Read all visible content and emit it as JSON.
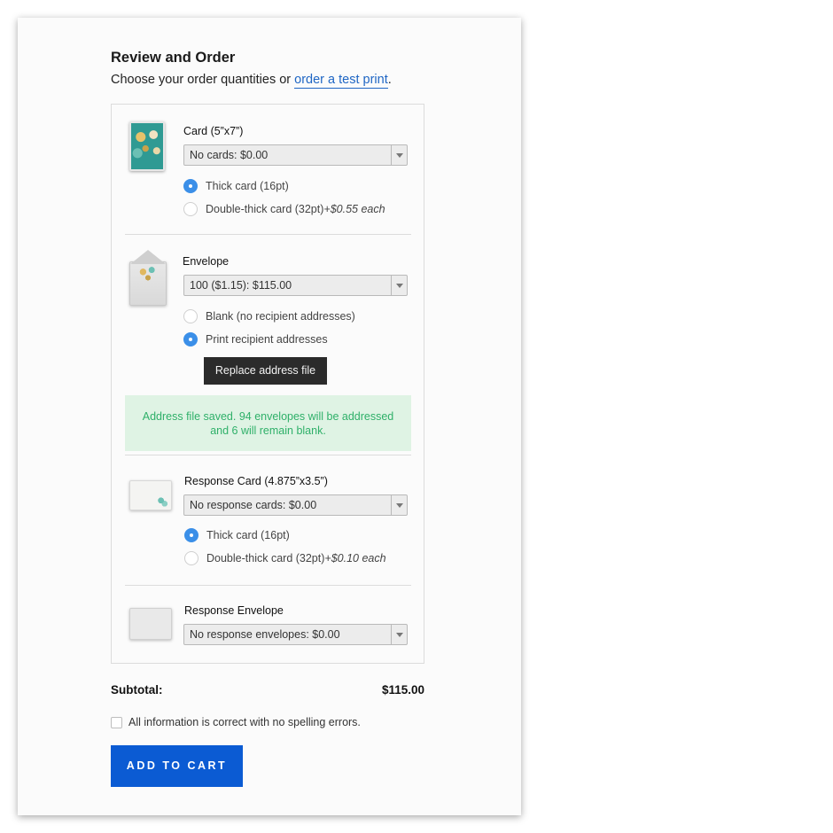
{
  "header": {
    "title": "Review and Order",
    "subtitle_text": "Choose your order quantities or ",
    "subtitle_link": "order a test print",
    "subtitle_end": "."
  },
  "card": {
    "label": "Card (5”x7”)",
    "select_value": "No cards:   $0.00",
    "options": [
      {
        "label": "Thick card (16pt)",
        "extra": "",
        "checked": true
      },
      {
        "label": "Double-thick card (32pt) ",
        "extra": "+$0.55 each",
        "checked": false
      }
    ]
  },
  "envelope": {
    "label": "Envelope",
    "select_value": "100 ($1.15):   $115.00",
    "options": [
      {
        "label": "Blank (no recipient addresses)",
        "checked": false
      },
      {
        "label": "Print recipient addresses",
        "checked": true
      }
    ],
    "replace_button": "Replace address file",
    "notice_line1": "Address file saved. 94 envelopes will be addressed",
    "notice_line2": "and 6 will remain blank."
  },
  "response_card": {
    "label": "Response Card (4.875”x3.5”)",
    "select_value": "No response cards:   $0.00",
    "options": [
      {
        "label": "Thick card (16pt)",
        "extra": "",
        "checked": true
      },
      {
        "label": "Double-thick card (32pt) ",
        "extra": "+$0.10 each",
        "checked": false
      }
    ]
  },
  "response_envelope": {
    "label": "Response Envelope",
    "select_value": "No response envelopes:   $0.00"
  },
  "summary": {
    "subtotal_label": "Subtotal:",
    "subtotal_value": "$115.00",
    "confirm_label": "All information is correct with no spelling errors.",
    "add_to_cart": "ADD TO CART"
  },
  "colors": {
    "accent": "#0b5bd3",
    "radio_selected": "#3b8fe8",
    "notice_bg": "#dff3e4",
    "notice_text": "#2fb069",
    "link": "#1f66c4"
  }
}
